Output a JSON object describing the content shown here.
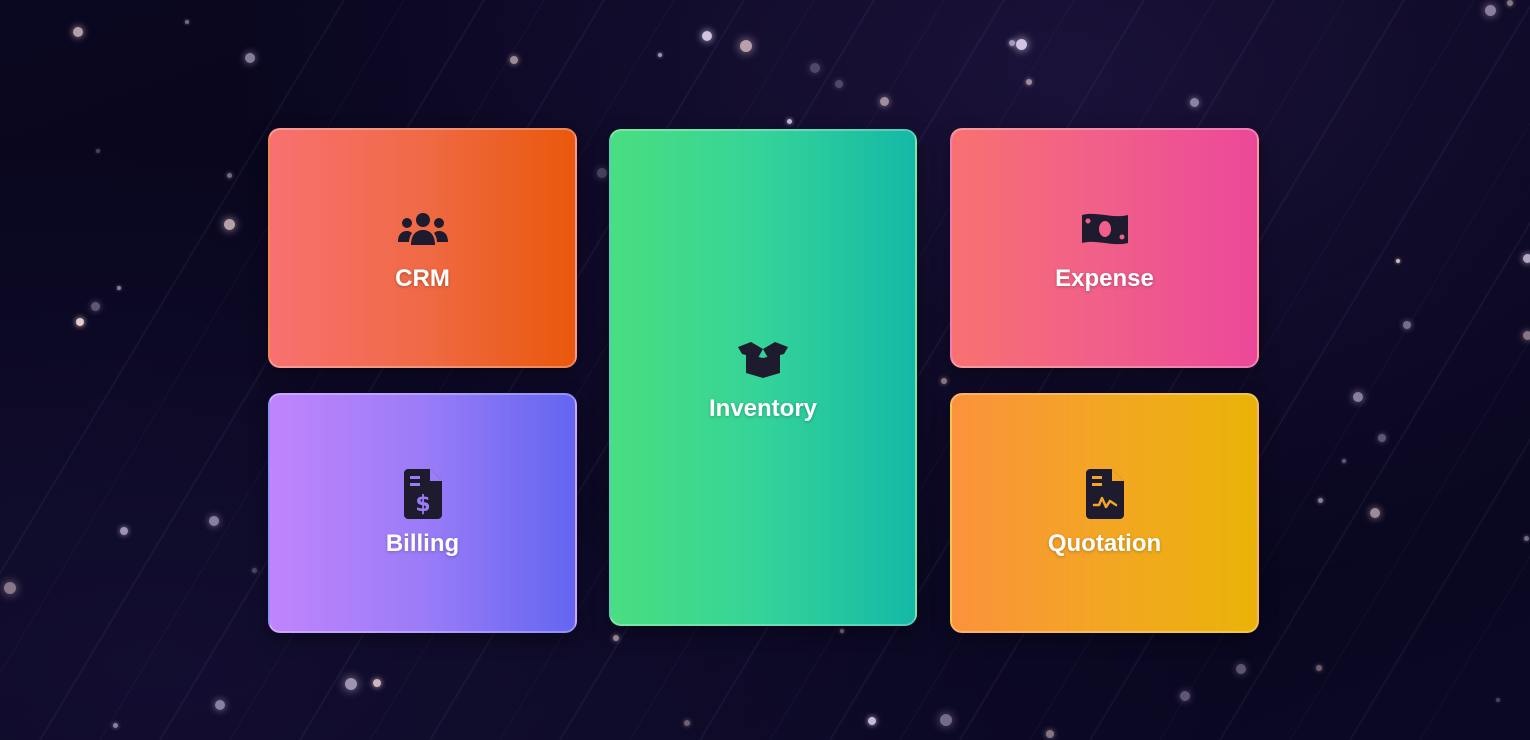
{
  "tiles": {
    "crm": {
      "label": "CRM",
      "icon": "users-icon",
      "gradient": [
        "#f87171",
        "#ea580c"
      ]
    },
    "billing": {
      "label": "Billing",
      "icon": "invoice-dollar-icon",
      "gradient": [
        "#c084fc",
        "#6366f1"
      ]
    },
    "inventory": {
      "label": "Inventory",
      "icon": "open-box-icon",
      "gradient": [
        "#4ade80",
        "#14b8a6"
      ]
    },
    "expense": {
      "label": "Expense",
      "icon": "money-bill-icon",
      "gradient": [
        "#f87171",
        "#ec4899"
      ]
    },
    "quotation": {
      "label": "Quotation",
      "icon": "signed-document-icon",
      "gradient": [
        "#fb923c",
        "#eab308"
      ]
    }
  },
  "colors": {
    "background": "#07051a",
    "icon": "#1e1b2e"
  }
}
